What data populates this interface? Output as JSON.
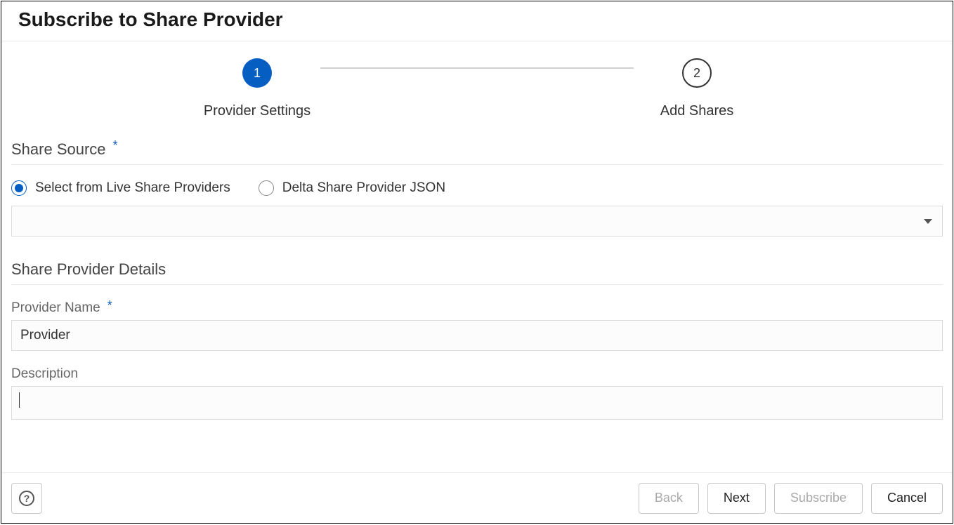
{
  "dialog": {
    "title": "Subscribe to Share Provider"
  },
  "stepper": {
    "steps": [
      {
        "number": "1",
        "label": "Provider Settings",
        "active": true
      },
      {
        "number": "2",
        "label": "Add Shares",
        "active": false
      }
    ]
  },
  "shareSource": {
    "title": "Share Source",
    "options": [
      {
        "label": "Select from Live Share Providers",
        "selected": true
      },
      {
        "label": "Delta Share Provider JSON",
        "selected": false
      }
    ],
    "dropdown_value": ""
  },
  "providerDetails": {
    "title": "Share Provider Details",
    "providerNameLabel": "Provider Name",
    "providerNameValue": "Provider",
    "descriptionLabel": "Description",
    "descriptionValue": ""
  },
  "footer": {
    "helpTooltip": "Help",
    "back": "Back",
    "next": "Next",
    "subscribe": "Subscribe",
    "cancel": "Cancel"
  }
}
